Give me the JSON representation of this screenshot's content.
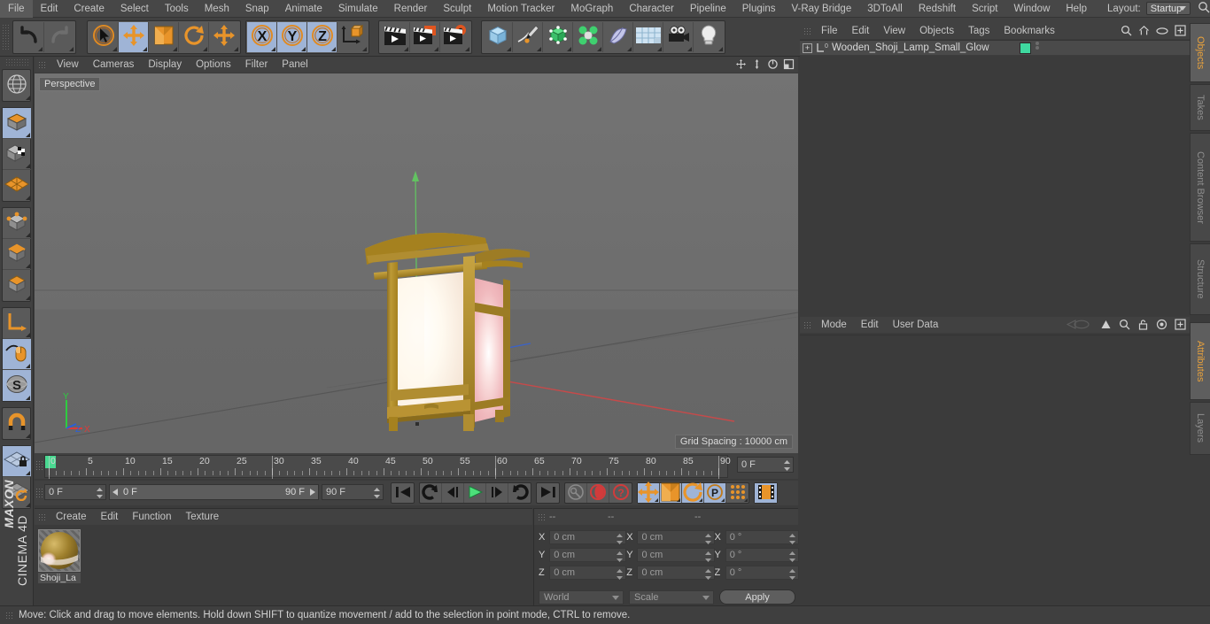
{
  "app": {
    "name": "MAXON CINEMA 4D",
    "brand_line1": "MAXON",
    "brand_line2": "CINEMA 4D"
  },
  "menubar": {
    "items": [
      "File",
      "Edit",
      "Create",
      "Select",
      "Tools",
      "Mesh",
      "Snap",
      "Animate",
      "Simulate",
      "Render",
      "Sculpt",
      "Motion Tracker",
      "MoGraph",
      "Character",
      "Pipeline",
      "Plugins",
      "V-Ray Bridge",
      "3DToAll",
      "Redshift",
      "Script",
      "Window",
      "Help"
    ],
    "layout_label": "Layout:",
    "layout_value": "Startup",
    "search_icon": "search-icon"
  },
  "toolbar": {
    "groups": [
      {
        "name": "undo-redo",
        "buttons": [
          {
            "name": "undo-button",
            "icon": "undo-arrow-icon",
            "active": false
          },
          {
            "name": "redo-button",
            "icon": "redo-arrow-icon",
            "active": false
          }
        ]
      },
      {
        "name": "transform-tools",
        "buttons": [
          {
            "name": "live-selection-tool",
            "icon": "cursor-circle-icon",
            "active": false
          },
          {
            "name": "move-tool",
            "icon": "move-arrows-icon",
            "active": true
          },
          {
            "name": "scale-tool",
            "icon": "scale-box-icon",
            "active": false
          },
          {
            "name": "rotate-tool",
            "icon": "rotate-circle-icon",
            "active": false
          },
          {
            "name": "free-move-tool",
            "icon": "move-arrows-icon",
            "active": false
          }
        ]
      },
      {
        "name": "axis-locks",
        "buttons": [
          {
            "name": "x-axis-lock",
            "icon": "x-axis-icon",
            "label": "X",
            "active": true
          },
          {
            "name": "y-axis-lock",
            "icon": "y-axis-icon",
            "label": "Y",
            "active": true
          },
          {
            "name": "z-axis-lock",
            "icon": "z-axis-icon",
            "label": "Z",
            "active": true
          },
          {
            "name": "world-object-coordinate-toggle",
            "icon": "world-axis-cube-icon",
            "active": false
          }
        ]
      },
      {
        "name": "render-tools",
        "buttons": [
          {
            "name": "render-view-button",
            "icon": "clapperboard-icon",
            "active": false
          },
          {
            "name": "render-to-picture-viewer-button",
            "icon": "clapperboard-render-icon",
            "active": false
          },
          {
            "name": "render-settings-button",
            "icon": "clapperboard-gear-icon",
            "active": false
          }
        ]
      },
      {
        "name": "object-creation",
        "buttons": [
          {
            "name": "add-cube-button",
            "icon": "cube-icon",
            "active": false
          },
          {
            "name": "add-spline-button",
            "icon": "pen-spline-icon",
            "active": false
          },
          {
            "name": "add-generator-button",
            "icon": "green-cube-generator-icon",
            "active": false
          },
          {
            "name": "add-mograph-button",
            "icon": "cloner-icon",
            "active": false
          },
          {
            "name": "add-deformer-button",
            "icon": "bend-deformer-icon",
            "active": false
          },
          {
            "name": "add-scene-object-button",
            "icon": "floor-grid-icon",
            "active": false
          },
          {
            "name": "add-camera-button",
            "icon": "camera-icon",
            "active": false
          },
          {
            "name": "add-light-button",
            "icon": "lightbulb-icon",
            "active": false
          }
        ]
      }
    ]
  },
  "left_toolbar": {
    "groups": [
      {
        "name": "undo-view",
        "buttons": [
          {
            "name": "undo-view-button",
            "icon": "globe-wire-icon",
            "active": false
          }
        ]
      },
      {
        "name": "editor-modes",
        "buttons": [
          {
            "name": "make-editable-button",
            "icon": "orange-cube-icon",
            "active": true
          },
          {
            "name": "model-mode-button",
            "icon": "checker-cube-icon",
            "active": false
          },
          {
            "name": "texture-mode-button",
            "icon": "texture-grid-icon",
            "active": false
          }
        ]
      },
      {
        "name": "component-modes",
        "buttons": [
          {
            "name": "points-mode-button",
            "icon": "points-cube-icon",
            "active": false
          },
          {
            "name": "edges-mode-button",
            "icon": "edges-cube-icon",
            "active": false
          },
          {
            "name": "polygons-mode-button",
            "icon": "polygons-cube-icon",
            "active": false
          }
        ]
      },
      {
        "name": "axis-tools",
        "buttons": [
          {
            "name": "enable-axis-modification-button",
            "icon": "axis-l-icon",
            "active": false
          },
          {
            "name": "viewport-solo-button",
            "icon": "mouse-icon",
            "active": true
          },
          {
            "name": "soft-selection-button",
            "icon": "s-sphere-icon",
            "active": true
          }
        ]
      },
      {
        "name": "snapping",
        "buttons": [
          {
            "name": "enable-snapping-button",
            "icon": "magnet-icon",
            "active": false
          }
        ]
      },
      {
        "name": "workplane",
        "buttons": [
          {
            "name": "lock-workplane-button",
            "icon": "workplane-lock-icon",
            "active": true
          },
          {
            "name": "align-workplane-button",
            "icon": "workplane-rotate-icon",
            "active": false
          }
        ]
      }
    ]
  },
  "viewport": {
    "menu": [
      "View",
      "Cameras",
      "Display",
      "Options",
      "Filter",
      "Panel"
    ],
    "label": "Perspective",
    "grid_spacing": "Grid Spacing : 10000 cm",
    "nav_icons": [
      "pan-icon",
      "dolly-icon",
      "rotate-icon",
      "maximize-icon"
    ],
    "axis_gizmo": {
      "y": "Y",
      "z": "Z",
      "x": "X",
      "y_color": "#2ecc40",
      "z_color": "#2b5fd9",
      "x_color": "#d93b3b"
    },
    "background_color": "#6e6e6e",
    "model": {
      "name": "Wooden Shoji Lamp",
      "wood_color": "#b08d31",
      "paper_color": "#fffaf2",
      "glow_color": "#f0b7bc"
    }
  },
  "timeline": {
    "ticks": [
      0,
      5,
      10,
      15,
      20,
      25,
      30,
      35,
      40,
      45,
      50,
      55,
      60,
      65,
      70,
      75,
      80,
      85,
      90
    ],
    "current_frame_display": "0 F",
    "playhead_frame": 0,
    "range_start": "0 F",
    "range_end": "90 F",
    "end_frame_field": "90 F",
    "start_frame_field": "0 F"
  },
  "playback": {
    "buttons": [
      {
        "name": "go-to-start-button",
        "icon": "skip-start-icon",
        "active": false
      },
      {
        "name": "go-to-previous-keyframe-button",
        "icon": "prev-key-icon",
        "active": false
      },
      {
        "name": "go-to-previous-frame-button",
        "icon": "step-back-icon",
        "active": false
      },
      {
        "name": "play-button",
        "icon": "play-icon",
        "active": false
      },
      {
        "name": "go-to-next-frame-button",
        "icon": "step-forward-icon",
        "active": false
      },
      {
        "name": "go-to-next-keyframe-button",
        "icon": "next-key-icon",
        "active": false
      },
      {
        "name": "go-to-end-button",
        "icon": "skip-end-icon",
        "active": false
      },
      {
        "name": "record-active-objects-button",
        "icon": "key-icon",
        "active": false
      },
      {
        "name": "autokeying-button",
        "icon": "record-circle-icon",
        "active": false
      },
      {
        "name": "keyframe-selection-button",
        "icon": "question-circle-icon",
        "active": false
      },
      {
        "name": "position-key-toggle",
        "icon": "move-arrows-icon",
        "active": true
      },
      {
        "name": "scale-key-toggle",
        "icon": "scale-box-icon",
        "active": true
      },
      {
        "name": "rotation-key-toggle",
        "icon": "rotate-circle-icon",
        "active": true
      },
      {
        "name": "parameter-key-toggle",
        "icon": "p-circle-icon",
        "active": true
      },
      {
        "name": "point-level-animation-toggle",
        "icon": "pla-dots-icon",
        "active": false
      },
      {
        "name": "timeline-filmstrip-button",
        "icon": "filmstrip-icon",
        "active": true
      }
    ]
  },
  "material_manager": {
    "menu": [
      "Create",
      "Edit",
      "Function",
      "Texture"
    ],
    "materials": [
      {
        "name": "Shoji_La",
        "preview": "sphere-preview"
      }
    ]
  },
  "coordinates": {
    "headers": [
      "--",
      "--",
      "--"
    ],
    "rows": [
      {
        "label": "X",
        "position": "0 cm",
        "size": "0 cm",
        "rotation": "0 °"
      },
      {
        "label": "Y",
        "position": "0 cm",
        "size": "0 cm",
        "rotation": "0 °"
      },
      {
        "label": "Z",
        "position": "0 cm",
        "size": "0 cm",
        "rotation": "0 °"
      }
    ],
    "coord_system": "World",
    "transform_mode": "Scale",
    "apply_label": "Apply"
  },
  "object_manager": {
    "menu": [
      "File",
      "Edit",
      "View",
      "Objects",
      "Tags",
      "Bookmarks"
    ],
    "header_icons": [
      "search-icon",
      "home-icon",
      "eye-icon",
      "add-layer-icon"
    ],
    "objects": [
      {
        "name": "Wooden_Shoji_Lamp_Small_Glow",
        "expandable": true,
        "tag_color": "#3fd9a0"
      }
    ]
  },
  "attributes": {
    "menu": [
      "Mode",
      "Edit",
      "User Data"
    ],
    "header_icons": [
      "history-icon",
      "pin-up-icon",
      "search-icon",
      "lock-icon",
      "target-icon",
      "add-icon"
    ],
    "content": ""
  },
  "side_tabs_top": [
    {
      "label": "Objects",
      "active": true
    },
    {
      "label": "Takes",
      "active": false
    },
    {
      "label": "Content Browser",
      "active": false
    },
    {
      "label": "Structure",
      "active": false
    }
  ],
  "side_tabs_bottom": [
    {
      "label": "Attributes",
      "active": true
    },
    {
      "label": "Layers",
      "active": false
    }
  ],
  "status_bar": {
    "message": "Move: Click and drag to move elements. Hold down SHIFT to quantize movement / add to the selection in point mode, CTRL to remove."
  }
}
